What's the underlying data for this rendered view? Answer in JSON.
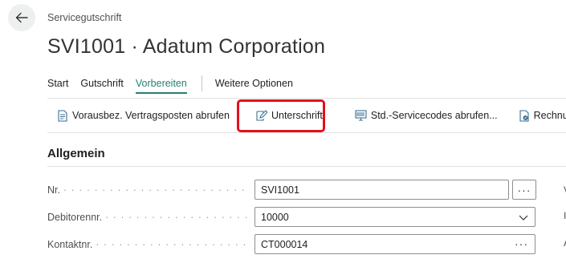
{
  "header": {
    "caption": "Servicegutschrift",
    "title": "SVI1001 · Adatum Corporation"
  },
  "tabs": [
    {
      "label": "Start"
    },
    {
      "label": "Gutschrift"
    },
    {
      "label": "Vorbereiten",
      "active": true
    },
    {
      "label": "Weitere Optionen"
    }
  ],
  "toolbar": {
    "items": [
      {
        "label": "Vorausbez. Vertragsposten abrufen",
        "icon": "document-lines-icon"
      },
      {
        "label": "Unterschrift",
        "icon": "signature-icon",
        "highlighted": true
      },
      {
        "label": "Std.-Servicecodes abrufen...",
        "icon": "standard-codes-icon"
      },
      {
        "label": "Rechnungsrab",
        "icon": "invoice-discount-icon"
      }
    ]
  },
  "section": {
    "title": "Allgemein"
  },
  "fields": [
    {
      "label": "Nr.",
      "value": "SVI1001",
      "control": "assist"
    },
    {
      "label": "Debitorennr.",
      "value": "10000",
      "control": "dropdown"
    },
    {
      "label": "Kontaktnr.",
      "value": "CT000014",
      "control": "inline-assist"
    }
  ],
  "colors": {
    "accent": "#24806f",
    "highlight": "#e3101c"
  }
}
